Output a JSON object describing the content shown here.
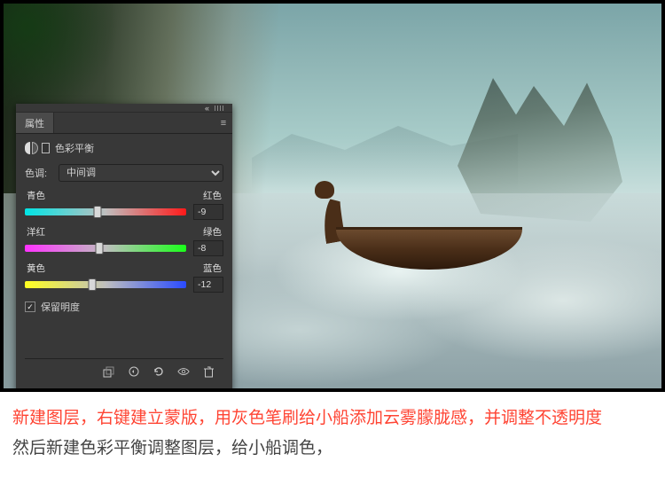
{
  "panel": {
    "tab_label": "属性",
    "adjustment_name": "色彩平衡",
    "tone_label": "色调:",
    "tone_value": "中间调",
    "sliders": {
      "cr": {
        "left": "青色",
        "right": "红色",
        "value": "-9",
        "pos": 45
      },
      "mg": {
        "left": "洋红",
        "right": "绿色",
        "value": "-8",
        "pos": 46
      },
      "yb": {
        "left": "黄色",
        "right": "蓝色",
        "value": "-12",
        "pos": 42
      }
    },
    "preserve_label": "保留明度",
    "preserve_checked": true
  },
  "caption": {
    "line1": "新建图层，右键建立蒙版，用灰色笔刷给小船添加云雾朦胧感，并调整不透明度",
    "line2": "然后新建色彩平衡调整图层，给小船调色，"
  }
}
